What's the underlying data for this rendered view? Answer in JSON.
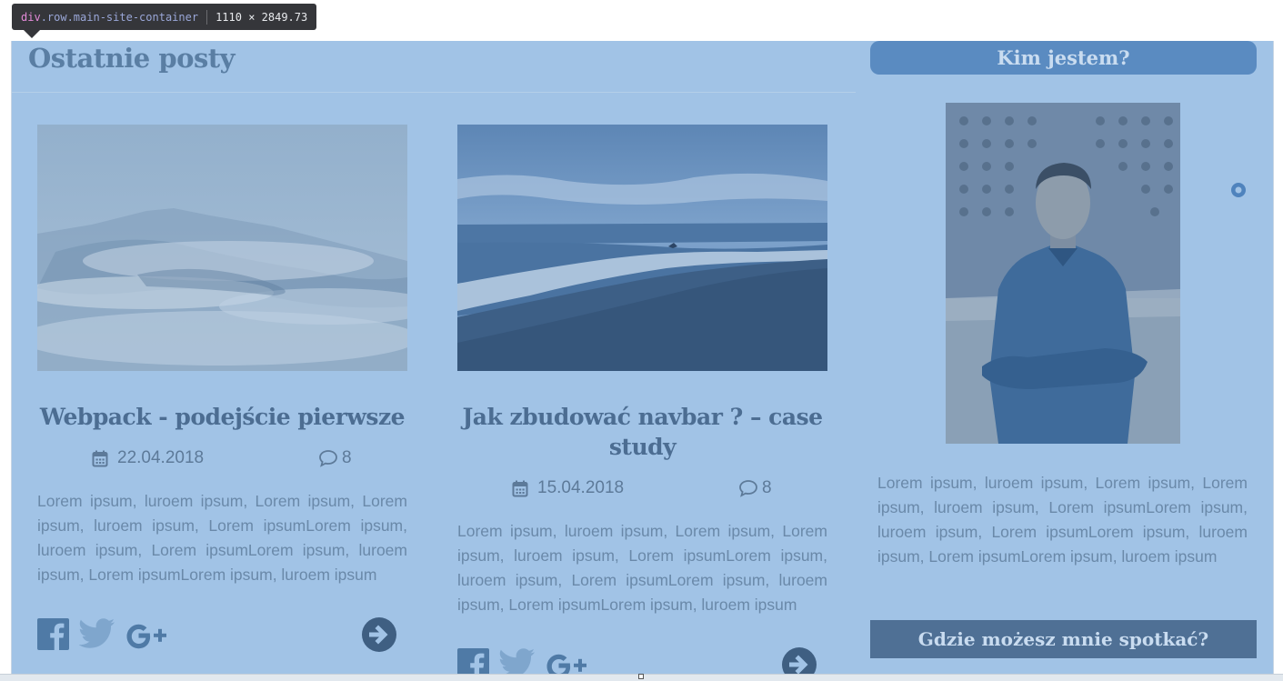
{
  "inspector": {
    "tag": "div",
    "classes": ".row.main-site-container",
    "dimensions": "1110 × 2849.73"
  },
  "main": {
    "section_title": "Ostatnie posty",
    "posts": [
      {
        "title": "Webpack - podejście pierwsze",
        "date": "22.04.2018",
        "comments": "8",
        "excerpt": "Lorem ipsum, luroem ipsum, Lorem ipsum, Lorem ipsum, luroem ipsum, Lorem ipsumLorem ipsum, luroem ipsum, Lorem ipsumLorem ipsum, luroem ipsum, Lorem ipsumLorem ipsum, luroem ipsum"
      },
      {
        "title": "Jak zbudować navbar ? – case study",
        "date": "15.04.2018",
        "comments": "8",
        "excerpt": "Lorem ipsum, luroem ipsum, Lorem ipsum, Lorem ipsum, luroem ipsum, Lorem ipsumLorem ipsum, luroem ipsum, Lorem ipsumLorem ipsum, luroem ipsum, Lorem ipsumLorem ipsum, luroem ipsum"
      }
    ]
  },
  "sidebar": {
    "about_heading": "Kim jestem?",
    "about_text": "Lorem ipsum, luroem ipsum, Lorem ipsum, Lorem ipsum, luroem ipsum, Lorem ipsumLorem ipsum, luroem ipsum, Lorem ipsumLorem ipsum, luroem ipsum, Lorem ipsumLorem ipsum, luroem ipsum",
    "meet_heading": "Gdzie możesz mnie spotkać?"
  },
  "icons": {
    "facebook": "facebook-icon",
    "twitter": "twitter-icon",
    "google_plus": "google-plus-icon",
    "read_more": "arrow-right-circle-icon",
    "calendar": "calendar-icon",
    "comment": "comment-icon"
  },
  "colors": {
    "overlay": "#a1c3e6",
    "heading": "#4c6d92",
    "side_header": "#5a8bc1",
    "side_header_dark": "#4f7095",
    "tooltip_bg": "#35363a"
  }
}
